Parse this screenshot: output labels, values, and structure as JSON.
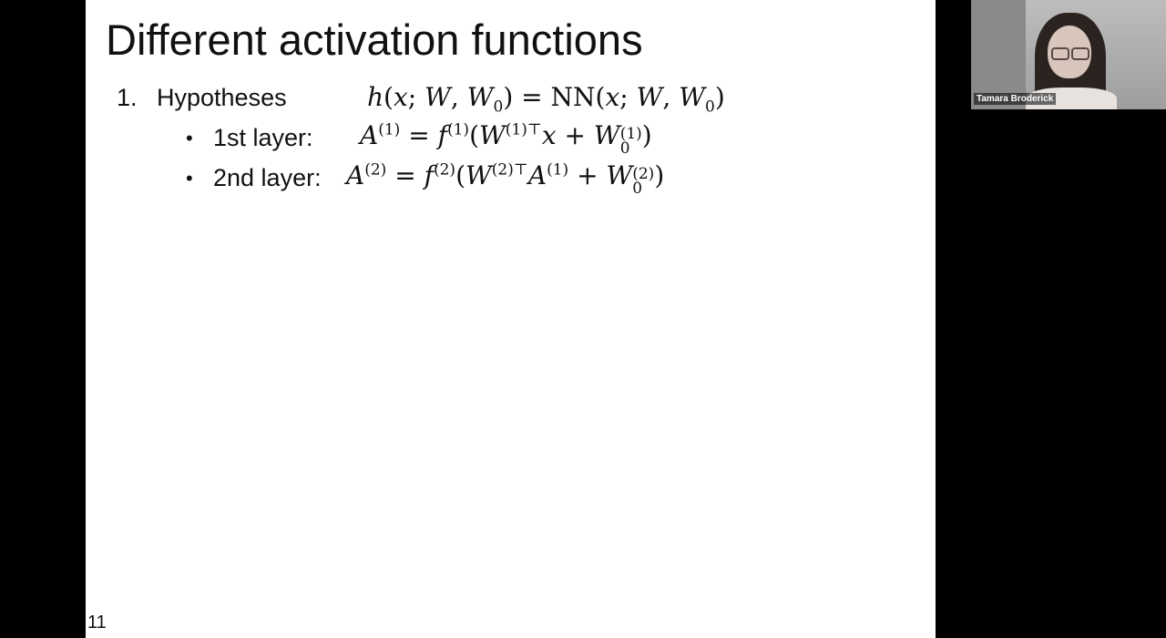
{
  "slide": {
    "title": "Different activation functions",
    "slide_number": "11",
    "items": [
      {
        "number": "1.",
        "label": "Hypotheses",
        "math": {
          "h": "h",
          "open": "(",
          "x": "x",
          "sep1": "; ",
          "W": "W",
          "sep2": ", ",
          "W0": "W",
          "sub0": "0",
          "close": ")",
          "eq": " = ",
          "NN": "NN",
          "open2": "(",
          "x2": "x",
          "sep3": "; ",
          "W2": "W",
          "sep4": ", ",
          "W02": "W",
          "sub02": "0",
          "close2": ")"
        }
      }
    ],
    "bullets": [
      {
        "bullet": "•",
        "label": "1st layer:",
        "math": {
          "A": "A",
          "supA": "(1)",
          "eq": " = ",
          "f": "f",
          "supf": "(1)",
          "open": "(",
          "W": "W",
          "supW": "(1)⊤",
          "x": "x",
          "plus": " + ",
          "W0": "W",
          "supW0": "(1)",
          "subW0": "0",
          "close": ")"
        }
      },
      {
        "bullet": "•",
        "label": "2nd layer:",
        "math": {
          "A": "A",
          "supA": "(2)",
          "eq": " = ",
          "f": "f",
          "supf": "(2)",
          "open": "(",
          "W": "W",
          "supW": "(2)⊤",
          "A1": "A",
          "supA1": "(1)",
          "plus": " + ",
          "W0": "W",
          "supW0": "(2)",
          "subW0": "0",
          "close": ")"
        }
      }
    ]
  },
  "video": {
    "participant_name": "Tamara Broderick"
  }
}
